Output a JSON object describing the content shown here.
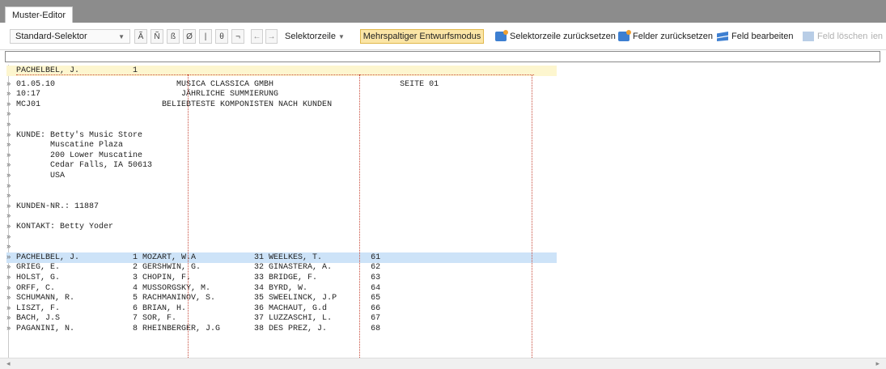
{
  "window": {
    "tab_title": "Muster-Editor"
  },
  "toolbar": {
    "selector_value": "Standard-Selektor",
    "char_buttons": [
      "Ã",
      "Ñ",
      "ß",
      "Ø",
      "|",
      "θ",
      "¬"
    ],
    "arrow_left": "←",
    "arrow_right": "→",
    "selector_row_label": "Selektorzeile",
    "multi_column_label": "Mehrspaltiger Entwurfsmodus",
    "reset_selector_row": "Selektorzeile zurücksetzen",
    "reset_fields": "Felder zurücksetzen",
    "edit_field": "Feld bearbeiten",
    "delete_field": "Feld löschen",
    "delete_field_tail": "ien"
  },
  "editor": {
    "lines": [
      {
        "marker": "",
        "text": "PACHELBEL, J.           1",
        "highlight": "yellow"
      },
      {
        "marker": "»",
        "text": "01.05.10                         MUSICA CLASSICA GMBH                          SEITE 01"
      },
      {
        "marker": "»",
        "text": "10:17                             JÄHRLICHE SUMMIERUNG"
      },
      {
        "marker": "»",
        "text": "MCJ01                         BELIEBTESTE KOMPONISTEN NACH KUNDEN"
      },
      {
        "marker": "»",
        "text": ""
      },
      {
        "marker": "»",
        "text": ""
      },
      {
        "marker": "»",
        "text": "KUNDE: Betty's Music Store"
      },
      {
        "marker": "»",
        "text": "       Muscatine Plaza"
      },
      {
        "marker": "»",
        "text": "       200 Lower Muscatine"
      },
      {
        "marker": "»",
        "text": "       Cedar Falls, IA 50613"
      },
      {
        "marker": "»",
        "text": "       USA"
      },
      {
        "marker": "»",
        "text": ""
      },
      {
        "marker": "»",
        "text": ""
      },
      {
        "marker": "»",
        "text": "KUNDEN-NR.: 11887"
      },
      {
        "marker": "»",
        "text": ""
      },
      {
        "marker": "»",
        "text": "KONTAKT: Betty Yoder"
      },
      {
        "marker": "»",
        "text": ""
      },
      {
        "marker": "»",
        "text": ""
      },
      {
        "marker": "»",
        "text": "PACHELBEL, J.           1 MOZART, W.A            31 WEELKES, T.          61",
        "highlight": "blue"
      },
      {
        "marker": "»",
        "text": "GRIEG, E.               2 GERSHWIN, G.           32 GINASTERA, A.        62"
      },
      {
        "marker": "»",
        "text": "HOLST, G.               3 CHOPIN, F.             33 BRIDGE, F.           63"
      },
      {
        "marker": "»",
        "text": "ORFF, C.                4 MUSSORGSKY, M.         34 BYRD, W.             64"
      },
      {
        "marker": "»",
        "text": "SCHUMANN, R.            5 RACHMANINOV, S.        35 SWEELINCK, J.P       65"
      },
      {
        "marker": "»",
        "text": "LISZT, F.               6 BRIAN, H.              36 MACHAUT, G.d         66"
      },
      {
        "marker": "»",
        "text": "BACH, J.S               7 SOR, F.                37 LUZZASCHI, L.        67"
      },
      {
        "marker": "»",
        "text": "PAGANINI, N.            8 RHEINBERGER, J.G       38 DES PREZ, J.         68"
      }
    ]
  },
  "scrollbar": {
    "left_arrow": "◂",
    "right_arrow": "▸"
  }
}
